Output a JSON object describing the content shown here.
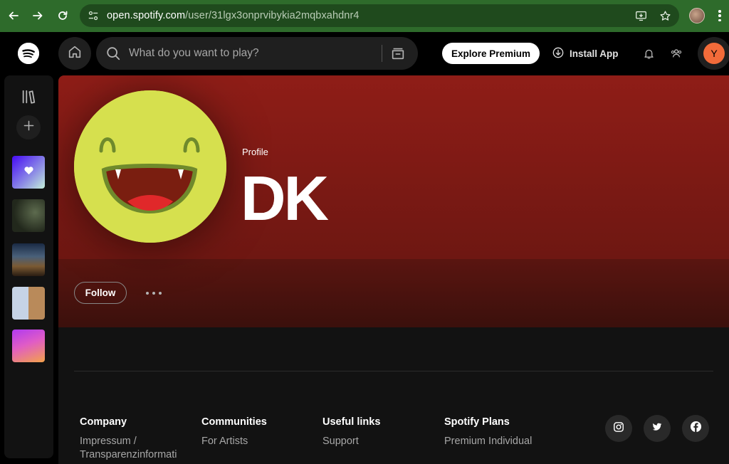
{
  "browser": {
    "url_host": "open.spotify.com",
    "url_path": "/user/31lgx3onprvibykia2mqbxahdnr4"
  },
  "topbar": {
    "search_placeholder": "What do you want to play?",
    "explore_label": "Explore Premium",
    "install_label": "Install App",
    "user_initial": "Y"
  },
  "profile": {
    "type_label": "Profile",
    "name": "DK",
    "follow_label": "Follow"
  },
  "footer": {
    "columns": [
      {
        "heading": "Company",
        "link": "Impressum / Transparenzinformati"
      },
      {
        "heading": "Communities",
        "link": "For Artists"
      },
      {
        "heading": "Useful links",
        "link": "Support"
      },
      {
        "heading": "Spotify Plans",
        "link": "Premium Individual"
      }
    ]
  },
  "colors": {
    "browser_green": "#2e6b2b",
    "hero_red": "#8f1d17",
    "avatar_yellow": "#d6e04e",
    "user_avatar_orange": "#f26b3a"
  }
}
